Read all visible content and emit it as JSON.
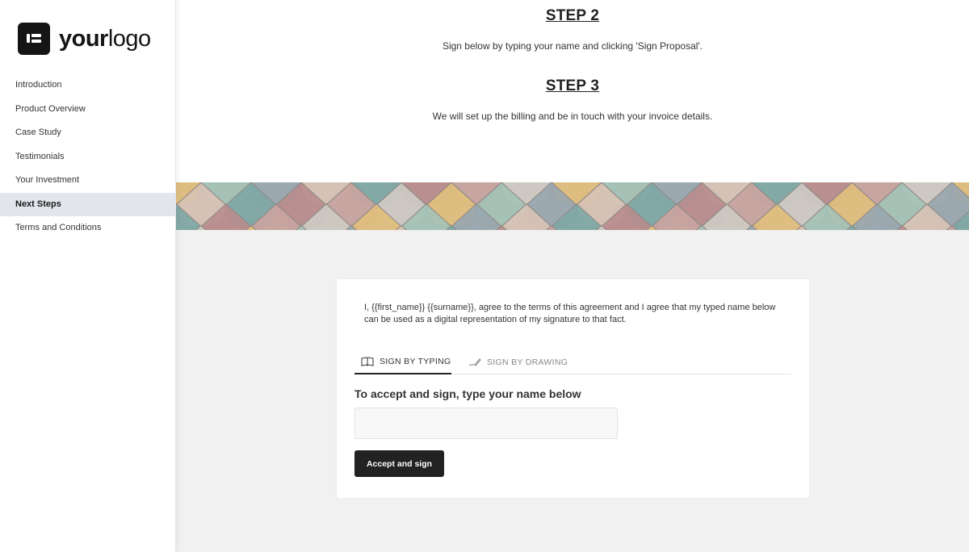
{
  "logo": {
    "text_bold": "your",
    "text_light": "logo"
  },
  "sidebar": {
    "items": [
      {
        "label": "Introduction"
      },
      {
        "label": "Product Overview"
      },
      {
        "label": "Case Study"
      },
      {
        "label": "Testimonials"
      },
      {
        "label": "Your Investment"
      },
      {
        "label": "Next Steps"
      },
      {
        "label": "Terms and Conditions"
      }
    ],
    "active_label": "Next Steps"
  },
  "steps": [
    {
      "title": "STEP 2",
      "text": "Sign below by typing your name and clicking 'Sign Proposal'."
    },
    {
      "title": "STEP 3",
      "text": "We will set up the billing and be in touch with your invoice details."
    }
  ],
  "signature": {
    "agreement_text": "I, {{first_name}} {{surname}}, agree to the terms of this agreement and I agree that my typed name below can be used as a digital representation of my signature to that fact.",
    "tabs": [
      {
        "label": "SIGN BY TYPING",
        "icon": "keyboard-icon",
        "active": true
      },
      {
        "label": "SIGN BY DRAWING",
        "icon": "pen-icon",
        "active": false
      }
    ],
    "heading": "To accept and sign, type your name below",
    "input_value": "",
    "input_placeholder": "",
    "button_label": "Accept and sign"
  },
  "colors": {
    "sidebar_active_bg": "#e3e5ec",
    "button_bg": "#222222",
    "lower_bg": "#f1f1f1",
    "tile_palette": [
      "#7fa9a6",
      "#a5c3b8",
      "#c9a4a0",
      "#d8c4b6",
      "#e2bf7e",
      "#b98d8e",
      "#9aa8b0",
      "#cfcac3"
    ]
  }
}
